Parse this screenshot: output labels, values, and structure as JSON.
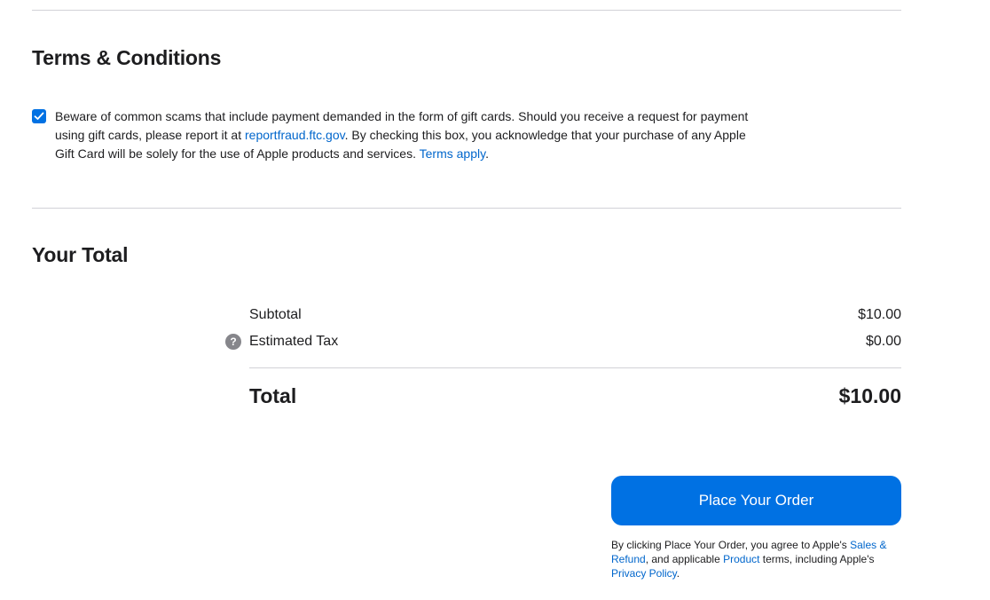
{
  "terms": {
    "title": "Terms & Conditions",
    "checkbox_checked": true,
    "text_1": "Beware of common scams that include payment demanded in the form of gift cards. Should you receive a request for payment using gift cards, please report it at ",
    "link_ftc": "reportfraud.ftc.gov",
    "text_2": ". By checking this box, you acknowledge that your purchase of any Apple Gift Card will be solely for the use of Apple products and services. ",
    "link_terms": "Terms apply",
    "text_3": "."
  },
  "total": {
    "title": "Your Total",
    "subtotal_label": "Subtotal",
    "subtotal_value": "$10.00",
    "tax_label": "Estimated Tax",
    "tax_help": "?",
    "tax_value": "$0.00",
    "total_label": "Total",
    "total_value": "$10.00"
  },
  "order": {
    "button_label": "Place Your Order",
    "legal_1": "By clicking Place Your Order, you agree to Apple's ",
    "link_sales": "Sales & Refund",
    "legal_2": ", and applicable ",
    "link_product": "Product",
    "legal_3": " terms, including Apple's ",
    "link_privacy": "Privacy Policy",
    "legal_4": "."
  },
  "colors": {
    "accent": "#0071e3",
    "link": "#0066cc",
    "text": "#1d1d1f",
    "divider": "#d2d2d7"
  },
  "icons": {
    "checkbox": "checkmark-icon",
    "tax_help": "question-mark-icon"
  }
}
